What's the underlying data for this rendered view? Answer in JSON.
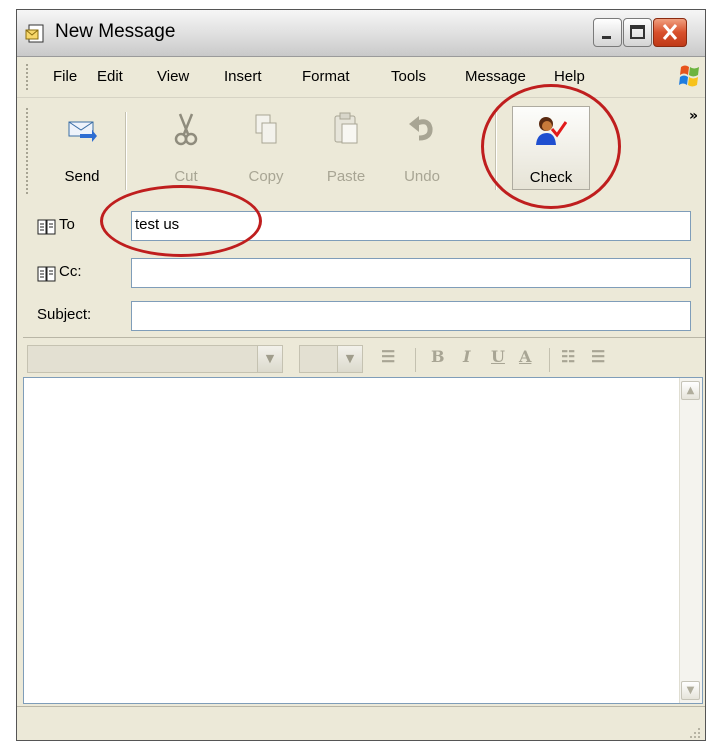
{
  "window": {
    "title": "New Message"
  },
  "menu": {
    "items": [
      "File",
      "Edit",
      "View",
      "Insert",
      "Format",
      "Tools",
      "Message",
      "Help"
    ]
  },
  "toolbar": {
    "buttons": [
      {
        "label": "Send",
        "icon": "send-icon",
        "enabled": true
      },
      {
        "label": "Cut",
        "icon": "scissors-icon",
        "enabled": false
      },
      {
        "label": "Copy",
        "icon": "copy-icon",
        "enabled": false
      },
      {
        "label": "Paste",
        "icon": "paste-icon",
        "enabled": false
      },
      {
        "label": "Undo",
        "icon": "undo-icon",
        "enabled": false
      },
      {
        "label": "Check",
        "icon": "check-names-icon",
        "enabled": true
      }
    ],
    "overflow": "»"
  },
  "header": {
    "to_label": "To",
    "to_value": "test us",
    "cc_label": "Cc:",
    "cc_value": "",
    "subject_label": "Subject:",
    "subject_value": ""
  },
  "format": {
    "font_value": "",
    "size_value": ""
  },
  "colors": {
    "chrome": "#ece9d8",
    "annotation": "#bf1e1e",
    "field_border": "#7f9db9"
  }
}
